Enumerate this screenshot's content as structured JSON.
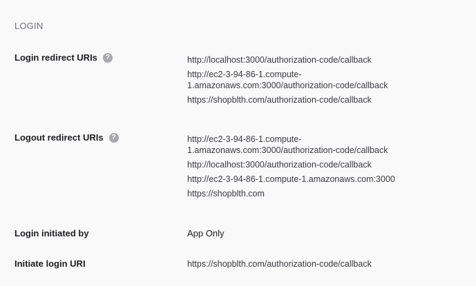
{
  "section": {
    "title": "LOGIN"
  },
  "login_redirect": {
    "label": "Login redirect URIs",
    "help_icon": "question-icon",
    "uris": [
      "http://localhost:3000/authorization-code/callback",
      "http://ec2-3-94-86-1.compute-1.amazonaws.com:3000/authorization-code/callback",
      "https://shopblth.com/authorization-code/callback"
    ]
  },
  "logout_redirect": {
    "label": "Logout redirect URIs",
    "help_icon": "question-icon",
    "uris": [
      "http://ec2-3-94-86-1.compute-1.amazonaws.com:3000/authorization-code/callback",
      "http://localhost:3000/authorization-code/callback",
      "http://ec2-3-94-86-1.compute-1.amazonaws.com:3000",
      "https://shopblth.com"
    ]
  },
  "login_initiated": {
    "label": "Login initiated by",
    "value": "App Only"
  },
  "initiate_login_uri": {
    "label": "Initiate login URI",
    "value": "https://shopblth.com/authorization-code/callback"
  }
}
